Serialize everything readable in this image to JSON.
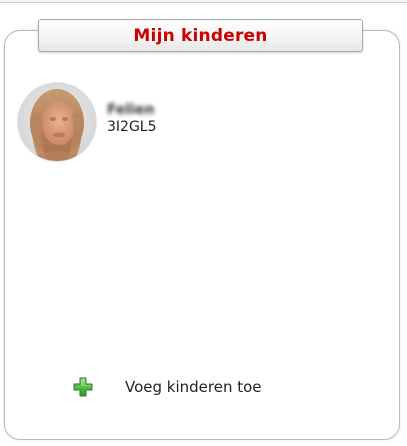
{
  "widget": {
    "title": "Mijn kinderen",
    "title_color": "#cc0000"
  },
  "children": [
    {
      "name": "Felien",
      "class_code": "3I2GL5",
      "avatar": "child-photo"
    }
  ],
  "actions": {
    "add_children_label": "Voeg kinderen toe",
    "add_icon": "green-plus-icon",
    "add_icon_color": "#3cb371"
  }
}
